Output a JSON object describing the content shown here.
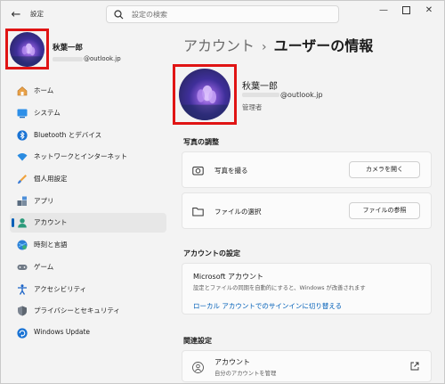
{
  "window": {
    "app_title": "設定",
    "search_placeholder": "設定の検索",
    "back_icon": "arrow-left-icon",
    "controls": [
      "minimize",
      "maximize",
      "close"
    ]
  },
  "user": {
    "name": "秋葉一郎",
    "email_suffix": "@outlook.jp",
    "role": "管理者"
  },
  "nav": {
    "items": [
      {
        "label": "ホーム",
        "icon": "home-icon",
        "active": false
      },
      {
        "label": "システム",
        "icon": "system-icon",
        "active": false
      },
      {
        "label": "Bluetooth とデバイス",
        "icon": "bluetooth-icon",
        "active": false
      },
      {
        "label": "ネットワークとインターネット",
        "icon": "network-icon",
        "active": false
      },
      {
        "label": "個人用設定",
        "icon": "personalization-icon",
        "active": false
      },
      {
        "label": "アプリ",
        "icon": "apps-icon",
        "active": false
      },
      {
        "label": "アカウント",
        "icon": "accounts-icon",
        "active": true
      },
      {
        "label": "時刻と言語",
        "icon": "time-language-icon",
        "active": false
      },
      {
        "label": "ゲーム",
        "icon": "gaming-icon",
        "active": false
      },
      {
        "label": "アクセシビリティ",
        "icon": "accessibility-icon",
        "active": false
      },
      {
        "label": "プライバシーとセキュリティ",
        "icon": "privacy-icon",
        "active": false
      },
      {
        "label": "Windows Update",
        "icon": "windows-update-icon",
        "active": false
      }
    ]
  },
  "main": {
    "breadcrumb_parent": "アカウント",
    "breadcrumb_separator": "›",
    "breadcrumb_current": "ユーザーの情報",
    "photo_section": {
      "title": "写真の調整",
      "take_photo_label": "写真を撮る",
      "open_camera_button": "カメラを開く",
      "choose_file_label": "ファイルの選択",
      "browse_files_button": "ファイルの参照"
    },
    "account_section": {
      "title": "アカウントの設定",
      "ms_account_title": "Microsoft アカウント",
      "ms_account_desc": "設定とファイルの同期を自動的にすると、Windows が改善されます",
      "local_account_link": "ローカル アカウントでのサインインに切り替える"
    },
    "related_section": {
      "title": "関連設定",
      "accounts_title": "アカウント",
      "accounts_desc": "自分のアカウントを管理"
    }
  },
  "colors": {
    "accent": "#005fb8",
    "highlight_box": "#e01414",
    "window_bg": "#f3f3f3",
    "card_bg": "#fbfbfb"
  }
}
